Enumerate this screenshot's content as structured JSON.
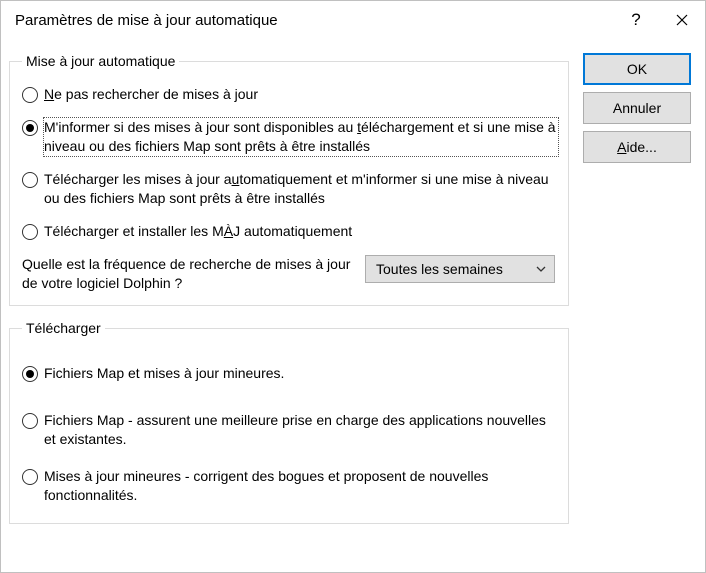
{
  "title": "Paramètres de mise à jour automatique",
  "buttons": {
    "ok": "OK",
    "cancel": "Annuler",
    "help_prefix": "A",
    "help_rest": "ide..."
  },
  "group1": {
    "legend": "Mise à jour automatique",
    "opt1_prefix": "N",
    "opt1_rest": "e pas rechercher de mises à jour",
    "opt2_a": "M'informer si des mises à jour sont disponibles au ",
    "opt2_b": "t",
    "opt2_c": "éléchargement et si une mise à niveau ou des fichiers Map sont prêts à être installés",
    "opt3_a": "Télécharger les mises à jour a",
    "opt3_b": "u",
    "opt3_c": "tomatiquement et m'informer si une mise à niveau ou des fichiers Map sont prêts à être installés",
    "opt4_a": "Télécharger et installer les M",
    "opt4_b": "À",
    "opt4_c": "J automatiquement",
    "freq_label": "Quelle est la fréquence de recherche de mises à jour de votre logiciel Dolphin ?",
    "freq_value": "Toutes les semaines"
  },
  "group2": {
    "legend": "Télécharger",
    "opt1": "Fichiers Map et mises à jour mineures.",
    "opt2": "Fichiers Map - assurent une meilleure prise en charge des applications nouvelles et existantes.",
    "opt3": "Mises à jour mineures - corrigent des bogues et proposent de nouvelles fonctionnalités."
  }
}
